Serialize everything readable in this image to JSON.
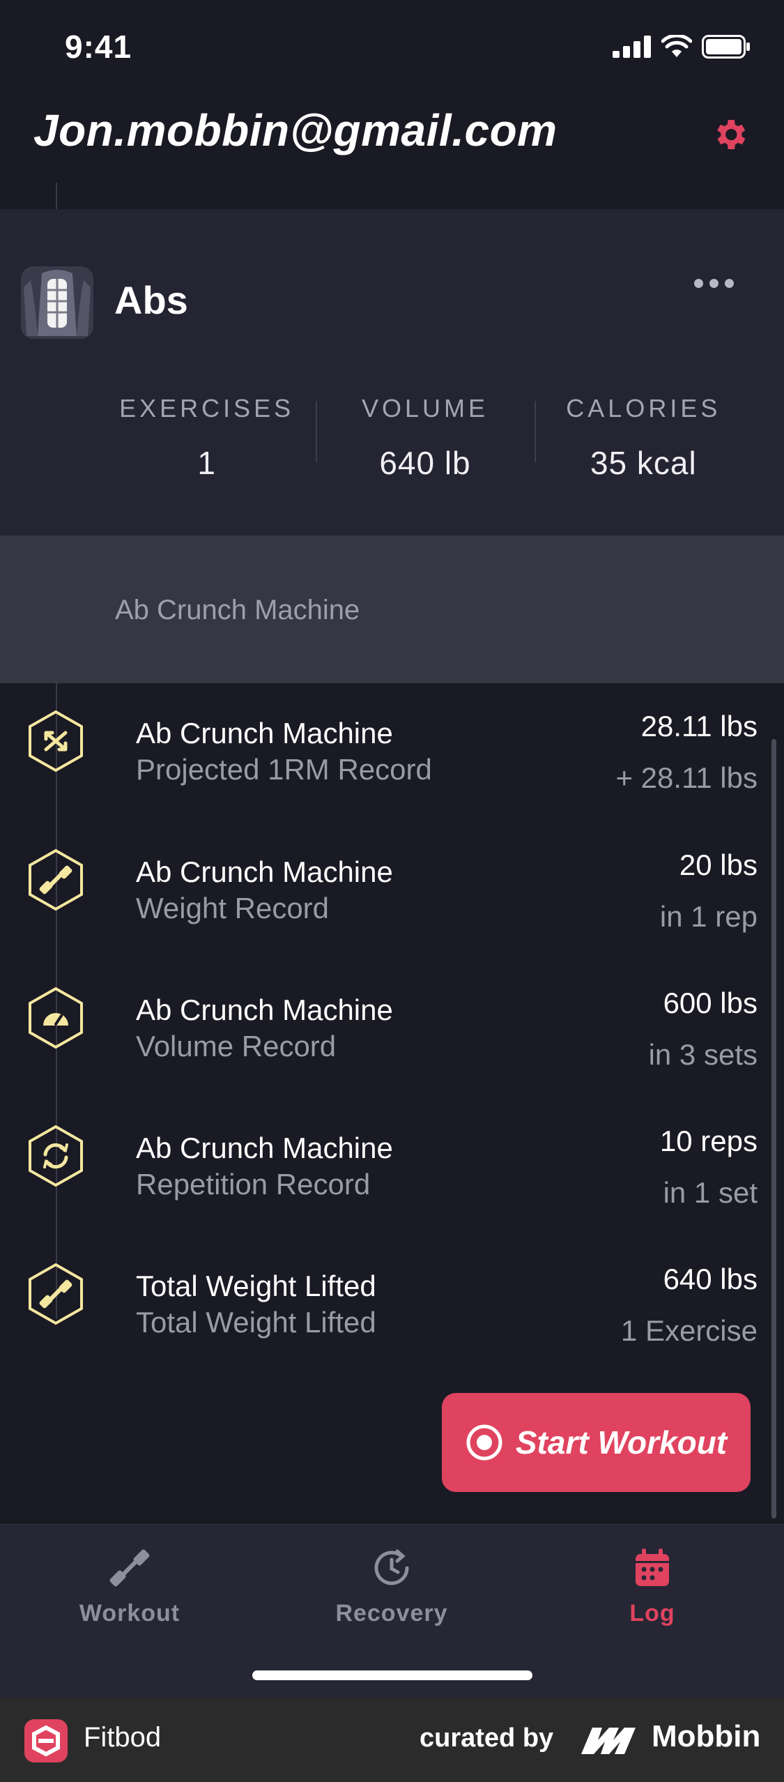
{
  "status_bar": {
    "time": "9:41"
  },
  "header": {
    "title": "Jon.mobbin@gmail.com",
    "settings_icon": "gear-icon"
  },
  "summary": {
    "muscle_group": "Abs",
    "stats": [
      {
        "label": "EXERCISES",
        "value": "1"
      },
      {
        "label": "VOLUME",
        "value": "640 lb"
      },
      {
        "label": "CALORIES",
        "value": "35 kcal"
      }
    ]
  },
  "section": {
    "label": "Ab Crunch Machine"
  },
  "records": [
    {
      "icon": "arrows-expand-icon",
      "name": "Ab Crunch Machine",
      "subtitle": "Projected 1RM Record",
      "value": "28.11 lbs",
      "extra": "+ 28.11 lbs"
    },
    {
      "icon": "dumbbell-icon",
      "name": "Ab Crunch Machine",
      "subtitle": "Weight Record",
      "value": "20 lbs",
      "extra": "in 1 rep"
    },
    {
      "icon": "gauge-icon",
      "name": "Ab Crunch Machine",
      "subtitle": "Volume Record",
      "value": "600 lbs",
      "extra": "in 3 sets"
    },
    {
      "icon": "repeat-icon",
      "name": "Ab Crunch Machine",
      "subtitle": "Repetition Record",
      "value": "10 reps",
      "extra": "in 1 set"
    },
    {
      "icon": "dumbbell-icon",
      "name": "Total Weight Lifted",
      "subtitle": "Total Weight Lifted",
      "value": "640 lbs",
      "extra": "1 Exercise"
    }
  ],
  "start_button": {
    "label": "Start Workout"
  },
  "tabs": [
    {
      "label": "Workout",
      "icon": "dumbbell-icon",
      "active": false
    },
    {
      "label": "Recovery",
      "icon": "clock-refresh-icon",
      "active": false
    },
    {
      "label": "Log",
      "icon": "calendar-icon",
      "active": true
    }
  ],
  "footer": {
    "app_name": "Fitbod",
    "curated_by": "curated by",
    "brand": "Mobbin"
  },
  "colors": {
    "accent": "#e0435f",
    "background": "#1a1a24",
    "icon_outline": "#f5e7a0"
  }
}
